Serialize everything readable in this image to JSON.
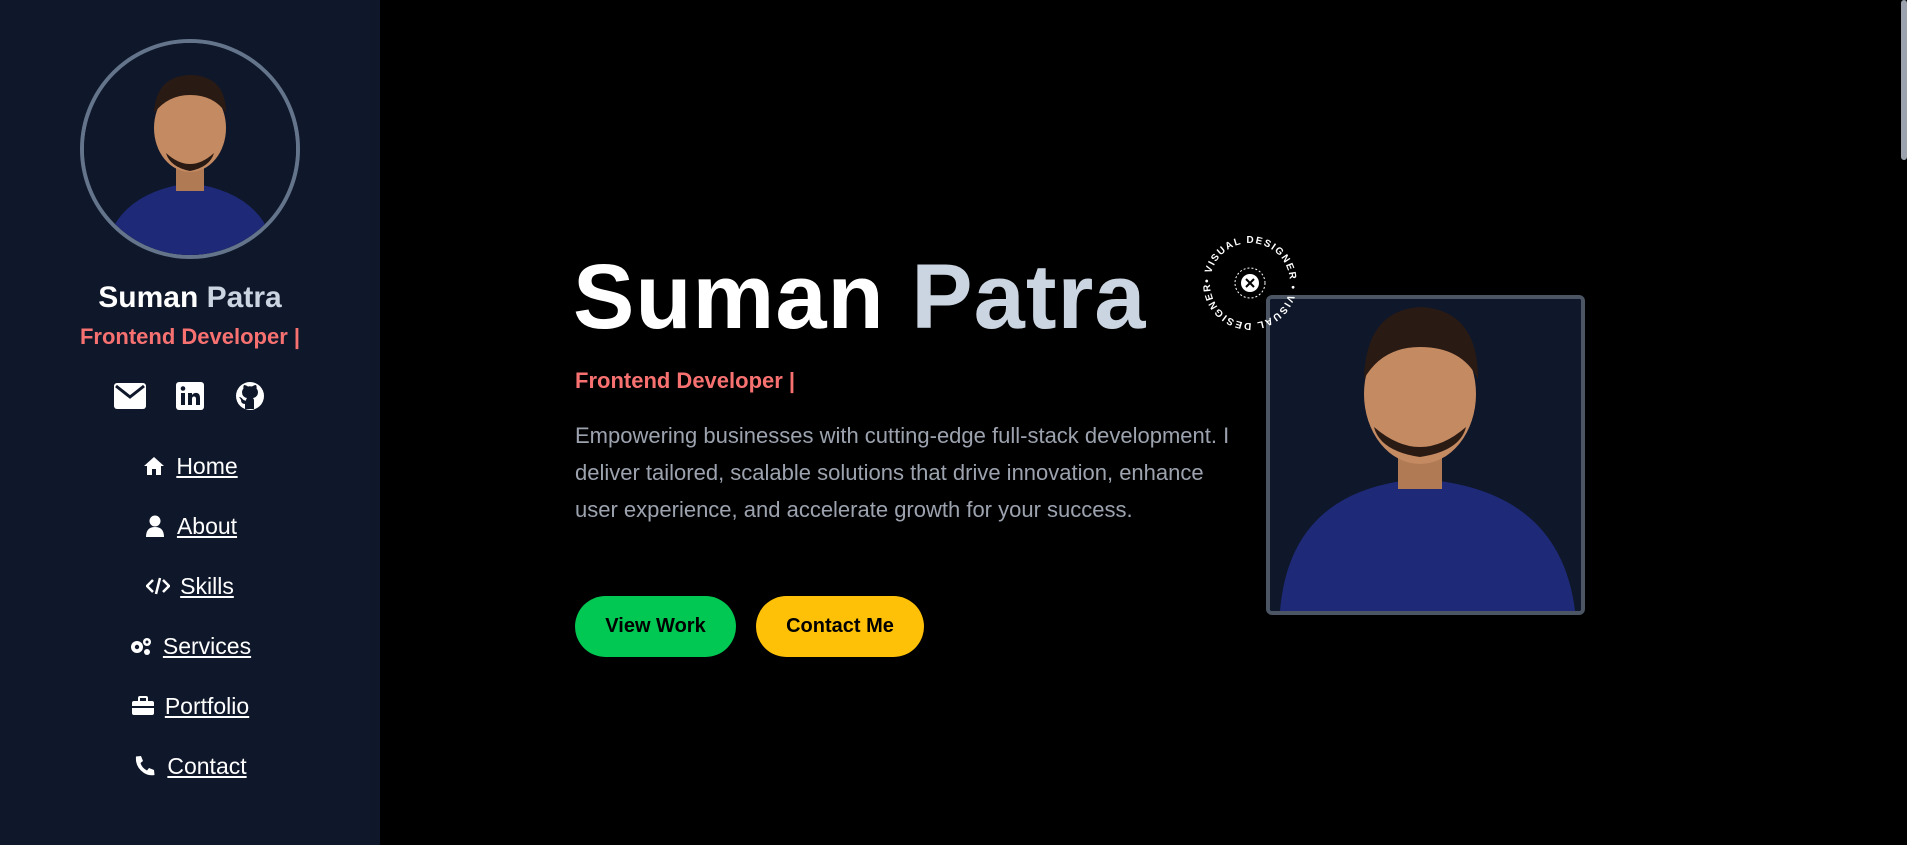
{
  "sidebar": {
    "first_name": "Suman",
    "last_name": "Patra",
    "role": "Frontend Developer |",
    "socials": [
      {
        "icon": "envelope-icon"
      },
      {
        "icon": "linkedin-icon"
      },
      {
        "icon": "github-icon"
      }
    ],
    "nav": [
      {
        "label": "Home",
        "icon": "home-icon"
      },
      {
        "label": "About",
        "icon": "user-icon"
      },
      {
        "label": "Skills",
        "icon": "code-icon"
      },
      {
        "label": "Services",
        "icon": "gears-icon"
      },
      {
        "label": "Portfolio",
        "icon": "briefcase-icon"
      },
      {
        "label": "Contact",
        "icon": "phone-icon"
      }
    ]
  },
  "hero": {
    "first_name": "Suman",
    "last_name": "Patra",
    "role": "Frontend Developer |",
    "description": "Empowering businesses with cutting-edge full-stack development. I deliver tailored, scalable solutions that drive innovation, enhance user experience, and accelerate growth for your success.",
    "view_work_label": "View Work",
    "contact_label": "Contact Me",
    "badge_text": "• VISUAL DESIGNER • VISUAL DESIGNER"
  },
  "colors": {
    "sidebar_bg": "#0f172a",
    "accent_red": "#f87171",
    "btn_green": "#00c853",
    "btn_yellow": "#ffc107"
  }
}
